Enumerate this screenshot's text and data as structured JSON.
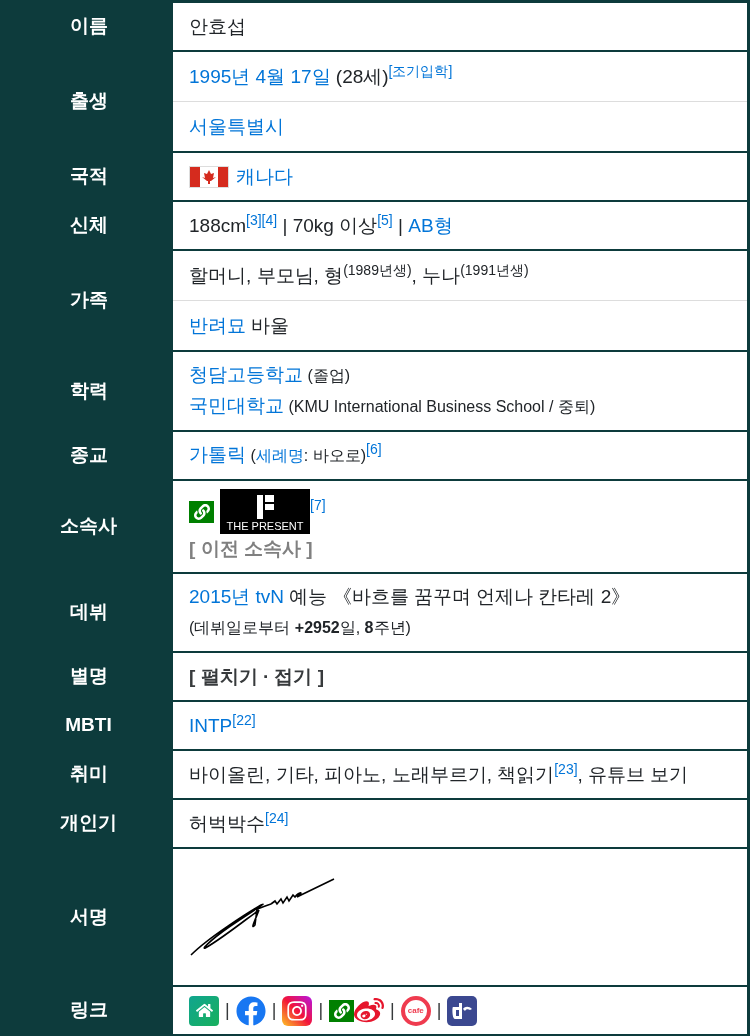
{
  "rows": [
    {
      "label": "이름",
      "cells": [
        {
          "lines": [
            [
              {
                "kind": "text",
                "text": "안효섭"
              }
            ]
          ]
        }
      ]
    },
    {
      "label": "출생",
      "cells": [
        {
          "lines": [
            [
              {
                "kind": "link",
                "text": "1995년 4월 17일"
              },
              {
                "kind": "text",
                "text": " (28세)"
              },
              {
                "kind": "ref",
                "text": "[조기입학]"
              }
            ]
          ]
        },
        {
          "lines": [
            [
              {
                "kind": "link",
                "text": "서울특별시"
              }
            ]
          ]
        }
      ]
    },
    {
      "label": "국적",
      "cells": [
        {
          "lines": [
            [
              {
                "kind": "flag"
              },
              {
                "kind": "link",
                "text": "캐나다"
              }
            ]
          ]
        }
      ]
    },
    {
      "label": "신체",
      "cells": [
        {
          "lines": [
            [
              {
                "kind": "text",
                "text": "188cm"
              },
              {
                "kind": "ref",
                "text": "[3]"
              },
              {
                "kind": "ref",
                "text": "[4]"
              },
              {
                "kind": "text",
                "text": " | 70kg 이상"
              },
              {
                "kind": "ref",
                "text": "[5]"
              },
              {
                "kind": "text",
                "text": " | "
              },
              {
                "kind": "link",
                "text": "AB형"
              }
            ]
          ]
        }
      ]
    },
    {
      "label": "가족",
      "cells": [
        {
          "lines": [
            [
              {
                "kind": "text",
                "text": "할머니, 부모님, 형"
              },
              {
                "kind": "note",
                "text": "(1989년생)"
              },
              {
                "kind": "text",
                "text": ", 누나"
              },
              {
                "kind": "note",
                "text": "(1991년생)"
              }
            ]
          ]
        },
        {
          "lines": [
            [
              {
                "kind": "link",
                "text": "반려묘"
              },
              {
                "kind": "text",
                "text": " 바울"
              }
            ]
          ]
        }
      ]
    },
    {
      "label": "학력",
      "cells": [
        {
          "lines": [
            [
              {
                "kind": "link",
                "text": "청담고등학교"
              },
              {
                "kind": "small",
                "text": " (졸업)"
              }
            ],
            [
              {
                "kind": "link",
                "text": "국민대학교"
              },
              {
                "kind": "small",
                "text": " (KMU International Business School / 중퇴)"
              }
            ]
          ]
        }
      ]
    },
    {
      "label": "종교",
      "cells": [
        {
          "lines": [
            [
              {
                "kind": "link",
                "text": "가톨릭"
              },
              {
                "kind": "small",
                "text": " ("
              },
              {
                "kind": "small_link",
                "text": "세례명"
              },
              {
                "kind": "small",
                "text": ": 바오로)"
              },
              {
                "kind": "ref",
                "text": "[6]"
              }
            ]
          ]
        }
      ]
    },
    {
      "label": "소속사",
      "cells": [
        {
          "lines": [
            [
              {
                "kind": "link_icon"
              },
              {
                "kind": "logo",
                "text": "THE PRESENT"
              },
              {
                "kind": "ref",
                "text": "[7]"
              }
            ],
            [
              {
                "kind": "toggle",
                "text": "[ 이전 소속사 ]",
                "muted": true
              }
            ]
          ]
        }
      ]
    },
    {
      "label": "데뷔",
      "cells": [
        {
          "lines": [
            [
              {
                "kind": "link",
                "text": "2015년 tvN"
              },
              {
                "kind": "text",
                "text": " 예능 《바흐를 꿈꾸며 언제나 칸타레 2》"
              }
            ],
            [
              {
                "kind": "small",
                "text": "(데뷔일로부터 "
              },
              {
                "kind": "small_bold",
                "text": "+2952"
              },
              {
                "kind": "small",
                "text": "일, "
              },
              {
                "kind": "small_bold",
                "text": "8"
              },
              {
                "kind": "small",
                "text": "주년)"
              }
            ]
          ]
        }
      ]
    },
    {
      "label": "별명",
      "cells": [
        {
          "lines": [
            [
              {
                "kind": "toggle",
                "text": "[ 펼치기 · 접기 ]",
                "muted": false
              }
            ]
          ]
        }
      ]
    },
    {
      "label": "MBTI",
      "cells": [
        {
          "lines": [
            [
              {
                "kind": "link",
                "text": "INTP"
              },
              {
                "kind": "ref",
                "text": "[22]"
              }
            ]
          ]
        }
      ]
    },
    {
      "label": "취미",
      "cells": [
        {
          "lines": [
            [
              {
                "kind": "text",
                "text": "바이올린, 기타, 피아노, 노래부르기, 책읽기"
              },
              {
                "kind": "ref",
                "text": "[23]"
              },
              {
                "kind": "text",
                "text": ", 유튜브 보기"
              }
            ]
          ]
        }
      ]
    },
    {
      "label": "개인기",
      "cells": [
        {
          "lines": [
            [
              {
                "kind": "text",
                "text": "허벅박수"
              },
              {
                "kind": "ref",
                "text": "[24]"
              }
            ]
          ]
        }
      ]
    },
    {
      "label": "서명",
      "cells": [
        {
          "lines": [
            [
              {
                "kind": "signature"
              }
            ]
          ]
        }
      ]
    },
    {
      "label": "링크",
      "cells": [
        {
          "lines": [
            [
              {
                "kind": "home"
              },
              {
                "kind": "sep",
                "text": "|"
              },
              {
                "kind": "facebook"
              },
              {
                "kind": "sep",
                "text": "|"
              },
              {
                "kind": "instagram"
              },
              {
                "kind": "sep",
                "text": "|"
              },
              {
                "kind": "link_icon"
              },
              {
                "kind": "weibo"
              },
              {
                "kind": "sep",
                "text": "|"
              },
              {
                "kind": "cafe",
                "text": "cafe"
              },
              {
                "kind": "sep",
                "text": "|"
              },
              {
                "kind": "dc"
              }
            ]
          ]
        }
      ]
    }
  ]
}
